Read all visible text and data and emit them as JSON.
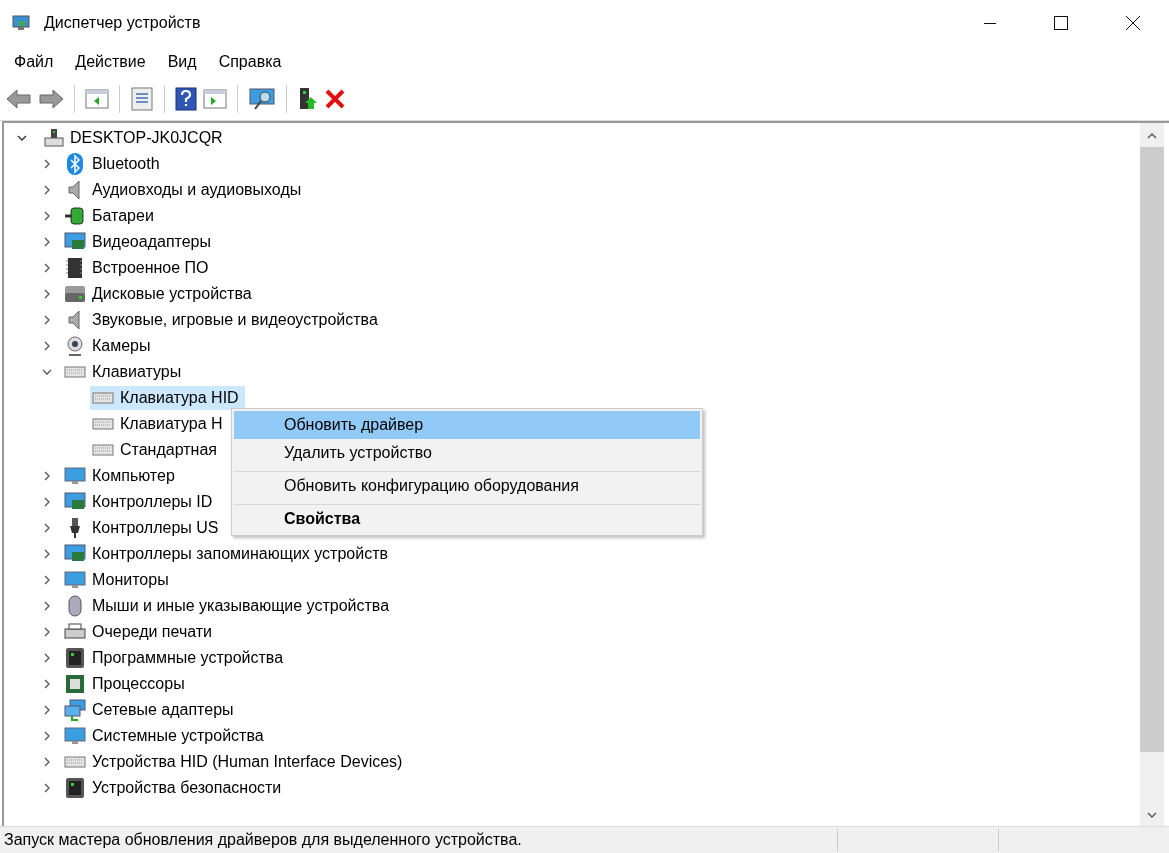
{
  "window": {
    "title": "Диспетчер устройств"
  },
  "menu": [
    "Файл",
    "Действие",
    "Вид",
    "Справка"
  ],
  "tree": {
    "label": "DESKTOP-JK0JCQR",
    "expanded": true,
    "children": [
      {
        "label": "Bluetooth",
        "expanded": false
      },
      {
        "label": "Аудиовходы и аудиовыходы",
        "expanded": false
      },
      {
        "label": "Батареи",
        "expanded": false
      },
      {
        "label": "Видеоадаптеры",
        "expanded": false
      },
      {
        "label": "Встроенное ПО",
        "expanded": false
      },
      {
        "label": "Дисковые устройства",
        "expanded": false
      },
      {
        "label": "Звуковые, игровые и видеоустройства",
        "expanded": false
      },
      {
        "label": "Камеры",
        "expanded": false
      },
      {
        "label": "Клавиатуры",
        "expanded": true,
        "children": [
          {
            "label": "Клавиатура HID",
            "selected": true
          },
          {
            "label": "Клавиатура H",
            "selected": false
          },
          {
            "label": "Стандартная",
            "selected": false
          }
        ]
      },
      {
        "label": "Компьютер",
        "expanded": false
      },
      {
        "label": "Контроллеры ID",
        "expanded": false
      },
      {
        "label": "Контроллеры US",
        "expanded": false
      },
      {
        "label": "Контроллеры запоминающих устройств",
        "expanded": false
      },
      {
        "label": "Мониторы",
        "expanded": false
      },
      {
        "label": "Мыши и иные указывающие устройства",
        "expanded": false
      },
      {
        "label": "Очереди печати",
        "expanded": false
      },
      {
        "label": "Программные устройства",
        "expanded": false
      },
      {
        "label": "Процессоры",
        "expanded": false
      },
      {
        "label": "Сетевые адаптеры",
        "expanded": false
      },
      {
        "label": "Системные устройства",
        "expanded": false
      },
      {
        "label": "Устройства HID (Human Interface Devices)",
        "expanded": false
      },
      {
        "label": "Устройства безопасности",
        "expanded": false
      }
    ]
  },
  "context_menu": [
    {
      "label": "Обновить драйвер",
      "selected": true,
      "default": false,
      "separator_before": false
    },
    {
      "label": "Удалить устройство",
      "selected": false,
      "default": false,
      "separator_before": false
    },
    {
      "label": "Обновить конфигурацию оборудования",
      "selected": false,
      "default": false,
      "separator_before": true
    },
    {
      "label": "Свойства",
      "selected": false,
      "default": true,
      "separator_before": true
    }
  ],
  "status_bar": "Запуск мастера обновления драйверов для выделенного устройства."
}
